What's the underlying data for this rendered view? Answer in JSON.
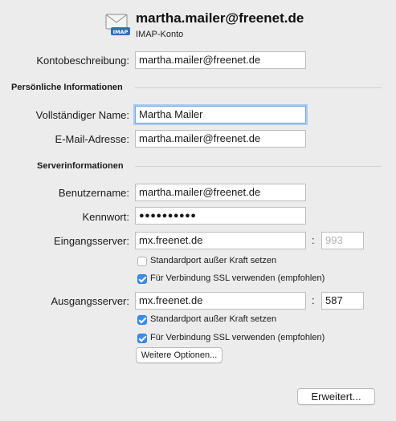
{
  "header": {
    "title": "martha.mailer@freenet.de",
    "subtitle": "IMAP-Konto",
    "icon": "envelope-imap-icon",
    "icon_badge": "IMAP"
  },
  "account_description": {
    "label": "Kontobeschreibung:",
    "value": "martha.mailer@freenet.de"
  },
  "personal": {
    "section_title": "Persönliche Informationen",
    "full_name_label": "Vollständiger Name:",
    "full_name_value": "Martha Mailer",
    "email_label": "E-Mail-Adresse:",
    "email_value": "martha.mailer@freenet.de"
  },
  "server": {
    "section_title": "Serverinformationen",
    "username_label": "Benutzername:",
    "username_value": "martha.mailer@freenet.de",
    "password_label": "Kennwort:",
    "password_value": "●●●●●●●●●●",
    "incoming_label": "Eingangsserver:",
    "incoming_value": "mx.freenet.de",
    "incoming_port": "993",
    "incoming_override_label": "Standardport außer Kraft setzen",
    "incoming_override_checked": false,
    "incoming_ssl_label": "Für Verbindung SSL verwenden (empfohlen)",
    "incoming_ssl_checked": true,
    "outgoing_label": "Ausgangsserver:",
    "outgoing_value": "mx.freenet.de",
    "outgoing_port": "587",
    "outgoing_override_label": "Standardport außer Kraft setzen",
    "outgoing_override_checked": true,
    "outgoing_ssl_label": "Für Verbindung SSL verwenden (empfohlen)",
    "outgoing_ssl_checked": true,
    "more_options_label": "Weitere Optionen...",
    "colon": ":"
  },
  "footer": {
    "advanced_label": "Erweitert..."
  },
  "colors": {
    "background": "#ececec",
    "checkbox_accent": "#3b8ef0",
    "focus_ring": "#a8cbf2"
  }
}
